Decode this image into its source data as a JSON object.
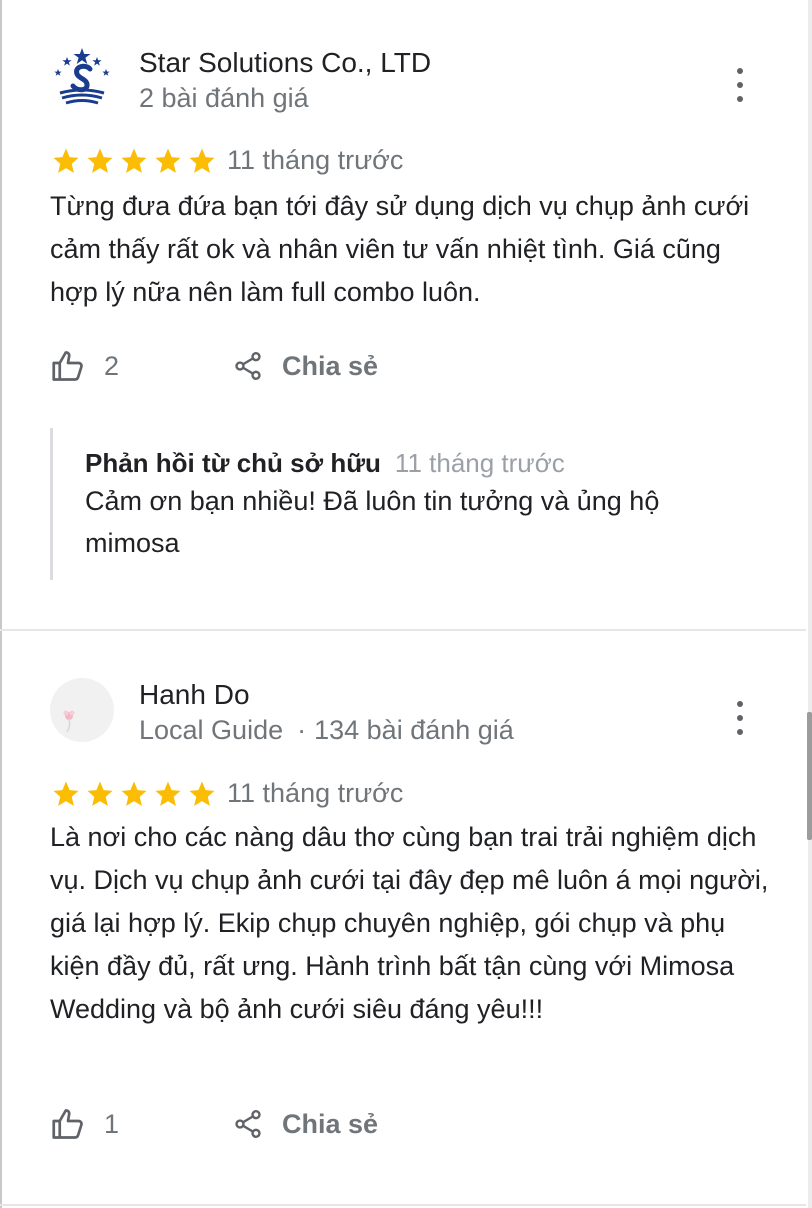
{
  "reviews": [
    {
      "author": "Star Solutions Co., LTD",
      "meta": "2 bài đánh giá",
      "rating": 5,
      "time": "11 tháng trước",
      "text": "Từng đưa đứa bạn tới đây sử dụng dịch vụ chụp ảnh cưới cảm thấy rất ok và  nhân viên tư vấn nhiệt tình. Giá cũng hợp lý nữa nên làm full combo luôn.",
      "likes": "2",
      "share_label": "Chia sẻ",
      "owner_reply": {
        "title": "Phản hồi từ chủ sở hữu",
        "time": "11 tháng trước",
        "text": "Cảm ơn bạn nhiều! Đã luôn tin tưởng và ủng hộ mimosa"
      }
    },
    {
      "author": "Hanh Do",
      "badge": "Local Guide",
      "meta": "134 bài đánh giá",
      "rating": 5,
      "time": "11 tháng trước",
      "text": "Là nơi cho các nàng dâu thơ cùng bạn trai trải nghiệm dịch vụ. Dịch vụ chụp ảnh cưới tại đây đẹp mê luôn á mọi người, giá lại hợp lý. Ekip chụp chuyên nghiệp, gói chụp và phụ kiện đầy đủ, rất ưng. Hành trình bất tận cùng với Mimosa Wedding và bộ ảnh cưới siêu đáng yêu!!!",
      "likes": "1",
      "share_label": "Chia sẻ"
    }
  ],
  "icons": {
    "star": "star-icon",
    "like": "thumb-up-icon",
    "share": "share-icon",
    "more": "more-vert-icon"
  },
  "colors": {
    "star": "#fbbc04",
    "secondary_text": "#70757a",
    "logo_blue": "#1a3c8f"
  }
}
